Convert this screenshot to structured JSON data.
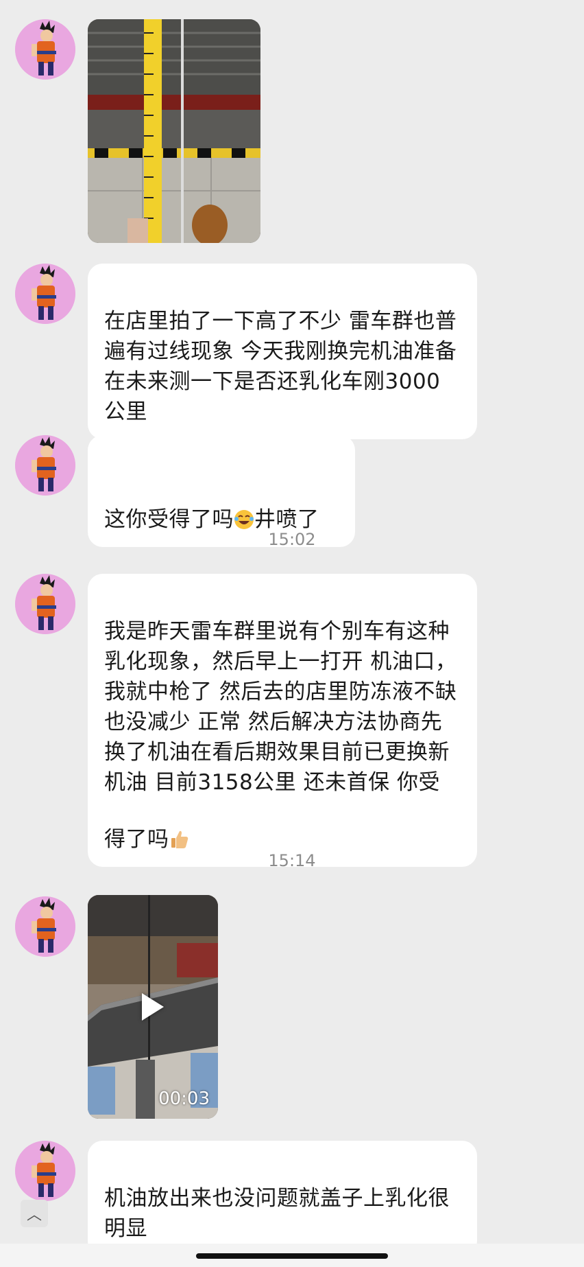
{
  "messages": [
    {
      "type": "image",
      "alt": "tape measure photo"
    },
    {
      "type": "text",
      "text": "在店里拍了一下高了不少  雷车群也普遍有过线现象  今天我刚换完机油准备在未来测一下是否还乳化车刚3000公里"
    },
    {
      "type": "text",
      "text_before": "这你受得了吗",
      "emoji": "joy-emoji",
      "text_after": "井喷了"
    },
    {
      "type": "time",
      "text": "15:02"
    },
    {
      "type": "text",
      "text_before": "我是昨天雷车群里说有个别车有这种乳化现象，然后早上一打开  机油口，我就中枪了  然后去的店里防冻液不缺也没减少  正常  然后解决方法协商先换了机油在看后期效果目前已更换新机油  目前3158公里  还未首保   你受得了吗",
      "emoji": "thumbs-up-emoji"
    },
    {
      "type": "time",
      "text": "15:14"
    },
    {
      "type": "video",
      "duration": "00:03"
    },
    {
      "type": "text",
      "text": "机油放出来也没问题就盖子上乳化很明显"
    }
  ],
  "colors": {
    "background": "#ececec",
    "bubble": "#ffffff",
    "avatar": "#e9a7e0"
  },
  "icons": {
    "scroll": "chevron-up-icon",
    "play": "play-icon"
  }
}
